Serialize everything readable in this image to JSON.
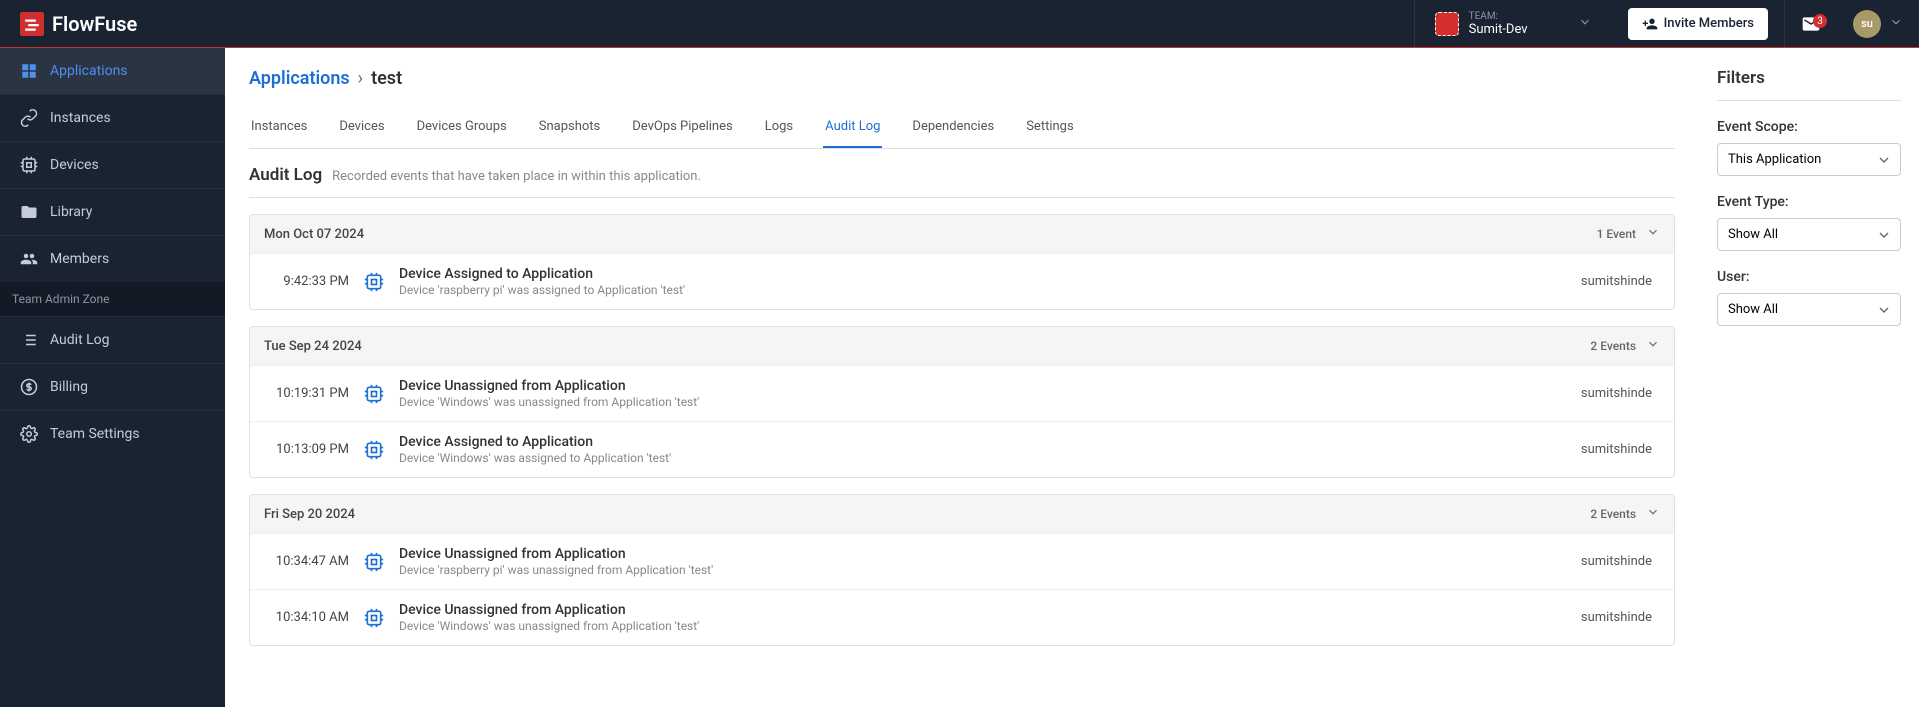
{
  "brand": "FlowFuse",
  "team": {
    "label": "TEAM:",
    "name": "Sumit-Dev"
  },
  "invite_label": "Invite Members",
  "notif_count": "3",
  "avatar_initials": "su",
  "sidebar": {
    "items": [
      {
        "label": "Applications"
      },
      {
        "label": "Instances"
      },
      {
        "label": "Devices"
      },
      {
        "label": "Library"
      },
      {
        "label": "Members"
      }
    ],
    "admin_header": "Team Admin Zone",
    "admin_items": [
      {
        "label": "Audit Log"
      },
      {
        "label": "Billing"
      },
      {
        "label": "Team Settings"
      }
    ]
  },
  "breadcrumb": {
    "parent": "Applications",
    "current": "test"
  },
  "tabs": [
    "Instances",
    "Devices",
    "Devices Groups",
    "Snapshots",
    "DevOps Pipelines",
    "Logs",
    "Audit Log",
    "Dependencies",
    "Settings"
  ],
  "active_tab": "Audit Log",
  "page": {
    "title": "Audit Log",
    "subtitle": "Recorded events that have taken place in within this application."
  },
  "days": [
    {
      "date": "Mon Oct 07 2024",
      "count": "1 Event",
      "events": [
        {
          "time": "9:42:33 PM",
          "title": "Device Assigned to Application",
          "desc": "Device 'raspberry pi' was assigned to Application 'test'",
          "user": "sumitshinde"
        }
      ]
    },
    {
      "date": "Tue Sep 24 2024",
      "count": "2 Events",
      "events": [
        {
          "time": "10:19:31 PM",
          "title": "Device Unassigned from Application",
          "desc": "Device 'Windows' was unassigned from Application 'test'",
          "user": "sumitshinde"
        },
        {
          "time": "10:13:09 PM",
          "title": "Device Assigned to Application",
          "desc": "Device 'Windows' was assigned to Application 'test'",
          "user": "sumitshinde"
        }
      ]
    },
    {
      "date": "Fri Sep 20 2024",
      "count": "2 Events",
      "events": [
        {
          "time": "10:34:47 AM",
          "title": "Device Unassigned from Application",
          "desc": "Device 'raspberry pi' was unassigned from Application 'test'",
          "user": "sumitshinde"
        },
        {
          "time": "10:34:10 AM",
          "title": "Device Unassigned from Application",
          "desc": "Device 'Windows' was unassigned from Application 'test'",
          "user": "sumitshinde"
        }
      ]
    }
  ],
  "filters": {
    "title": "Filters",
    "scope": {
      "label": "Event Scope:",
      "value": "This Application"
    },
    "type": {
      "label": "Event Type:",
      "value": "Show All"
    },
    "user": {
      "label": "User:",
      "value": "Show All"
    }
  }
}
